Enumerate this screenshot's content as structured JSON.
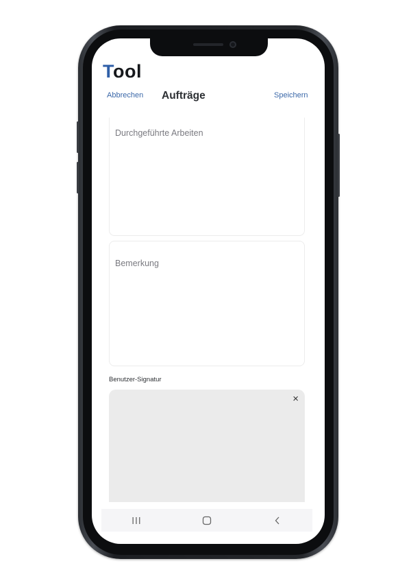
{
  "app": {
    "logo_first": "T",
    "logo_rest": "ool"
  },
  "header": {
    "cancel_label": "Abbrechen",
    "title": "Aufträge",
    "save_label": "Speichern"
  },
  "form": {
    "work_placeholder": "Durchgeführte Arbeiten",
    "remark_placeholder": "Bemerkung",
    "signature_label": "Benutzer-Signatur",
    "signature_clear_symbol": "×"
  },
  "navbar": {
    "icons": [
      "recent-apps-icon",
      "home-icon",
      "back-icon"
    ]
  },
  "colors": {
    "accent": "#3a67a8",
    "logo_accent": "#2f5fa8",
    "signature_bg": "#ebebeb"
  }
}
